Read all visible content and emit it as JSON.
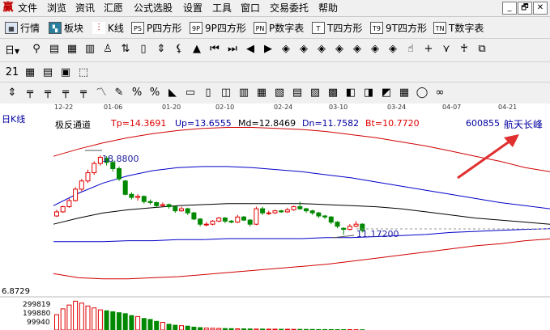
{
  "menubar": {
    "app_icon": "赢",
    "items": [
      "文件",
      "浏览",
      "资讯",
      "汇愿",
      "公式选股",
      "设置",
      "工具",
      "窗口",
      "交易委托",
      "帮助"
    ],
    "win_controls": [
      "_",
      "🗗",
      "✕"
    ]
  },
  "view_tabs": [
    {
      "icon": "grid-icon",
      "label": "行情"
    },
    {
      "icon": "blocks-icon",
      "label": "板块"
    },
    {
      "icon": "candle-icon",
      "label": "K线"
    },
    {
      "icon": "PS",
      "label": "P四方形"
    },
    {
      "icon": "9P",
      "label": "9P四方形"
    },
    {
      "icon": "PN",
      "label": "P数字表"
    },
    {
      "icon": "T",
      "label": "T四方形"
    },
    {
      "icon": "T9",
      "label": "9T四方形"
    },
    {
      "icon": "TN",
      "label": "T数字表"
    }
  ],
  "period_selector": "日",
  "toolbar2_glyphs": [
    "⚲",
    "▤",
    "▦",
    "▥",
    "♙",
    "⇅",
    "▯",
    "⇕",
    "⚸",
    "▲",
    "⏮",
    "⏭",
    "◀",
    "▶",
    "◈",
    "◈",
    "◈",
    "◈",
    "◈",
    "◈",
    "◈",
    "☝",
    "+",
    "⋎",
    "♰",
    "⧉"
  ],
  "toolbar3_glyphs": [
    "21",
    "▦",
    "▤",
    "▣",
    "⬚"
  ],
  "toolbar4_glyphs": [
    "⇕",
    "╤",
    "╤",
    "╤",
    "╤",
    "〽",
    "✎",
    "%",
    "%",
    "◣",
    "▭",
    "▯",
    "◫",
    "▥",
    "▦",
    "▧",
    "▤",
    "▨",
    "▩",
    "◧",
    "◨",
    "◩",
    "▦",
    "◯",
    "∞"
  ],
  "date_axis": [
    "12-22",
    "01-06",
    "01-20",
    "02-10",
    "02-24",
    "03-10",
    "03-24",
    "04-07",
    "04-21"
  ],
  "chart_title": "日K线",
  "indicator": {
    "name": "极反通道",
    "tp": "Tp=14.3691",
    "up": "Up=13.6555",
    "md": "Md=12.8469",
    "dn": "Dn=11.7582",
    "bt": "Bt=10.7720"
  },
  "stock": {
    "code": "600855",
    "name": "航天长峰"
  },
  "annotations": {
    "high_price": "18.8800",
    "low_price": "11.17200"
  },
  "y_labels": {
    "price_low": "6.8729",
    "vol_1": "299819",
    "vol_2": "199880",
    "vol_3": "99940"
  },
  "colors": {
    "up_candle": "#e00000",
    "down_candle": "#008800",
    "tp_band": "#d00000",
    "up_band": "#0000c8",
    "md_line": "#000000",
    "dn_band": "#0000c8",
    "bt_band": "#d00000",
    "arrow": "#e03030",
    "indicator_text": "#0000a0",
    "tp_text": "#e00000",
    "stock_text": "#0000a0"
  },
  "chart_data": {
    "type": "candlestick",
    "x": [
      "12-22",
      "01-06",
      "01-20",
      "02-10",
      "02-24",
      "03-10",
      "03-24",
      "04-07",
      "04-21"
    ],
    "candles": [
      {
        "open": 13.0,
        "close": 13.4,
        "high": 13.6,
        "low": 12.9
      },
      {
        "open": 13.4,
        "close": 13.9,
        "high": 14.0,
        "low": 13.3
      },
      {
        "open": 13.9,
        "close": 14.5,
        "high": 14.7,
        "low": 13.8
      },
      {
        "open": 14.5,
        "close": 15.6,
        "high": 15.8,
        "low": 14.4
      },
      {
        "open": 15.6,
        "close": 16.4,
        "high": 16.6,
        "low": 15.4
      },
      {
        "open": 16.4,
        "close": 17.2,
        "high": 17.5,
        "low": 16.2
      },
      {
        "open": 17.2,
        "close": 18.1,
        "high": 18.3,
        "low": 17.0
      },
      {
        "open": 18.1,
        "close": 18.7,
        "high": 18.88,
        "low": 17.9
      },
      {
        "open": 18.6,
        "close": 18.2,
        "high": 18.8,
        "low": 17.9
      },
      {
        "open": 18.2,
        "close": 17.6,
        "high": 18.4,
        "low": 17.3
      },
      {
        "open": 17.6,
        "close": 16.6,
        "high": 17.8,
        "low": 16.4
      },
      {
        "open": 16.4,
        "close": 15.1,
        "high": 16.5,
        "low": 15.0
      },
      {
        "open": 15.1,
        "close": 14.8,
        "high": 15.3,
        "low": 14.6
      },
      {
        "open": 14.8,
        "close": 14.9,
        "high": 15.1,
        "low": 14.5
      },
      {
        "open": 14.9,
        "close": 14.4,
        "high": 15.0,
        "low": 14.2
      },
      {
        "open": 14.4,
        "close": 14.3,
        "high": 14.6,
        "low": 14.1
      },
      {
        "open": 14.3,
        "close": 14.0,
        "high": 14.4,
        "low": 13.8
      },
      {
        "open": 14.0,
        "close": 14.1,
        "high": 14.3,
        "low": 13.9
      },
      {
        "open": 14.1,
        "close": 13.9,
        "high": 14.2,
        "low": 13.7
      },
      {
        "open": 13.9,
        "close": 13.5,
        "high": 14.0,
        "low": 13.3
      },
      {
        "open": 13.5,
        "close": 13.7,
        "high": 13.9,
        "low": 13.4
      },
      {
        "open": 13.7,
        "close": 13.3,
        "high": 13.8,
        "low": 13.1
      },
      {
        "open": 13.3,
        "close": 12.7,
        "high": 13.4,
        "low": 12.6
      },
      {
        "open": 12.7,
        "close": 12.2,
        "high": 12.8,
        "low": 12.0
      },
      {
        "open": 12.2,
        "close": 12.2,
        "high": 12.4,
        "low": 12.0
      },
      {
        "open": 12.2,
        "close": 12.5,
        "high": 12.6,
        "low": 12.1
      },
      {
        "open": 12.5,
        "close": 12.8,
        "high": 12.9,
        "low": 12.4
      },
      {
        "open": 12.8,
        "close": 12.5,
        "high": 12.9,
        "low": 12.3
      },
      {
        "open": 12.5,
        "close": 12.4,
        "high": 12.6,
        "low": 12.3
      },
      {
        "open": 12.4,
        "close": 12.9,
        "high": 13.1,
        "low": 12.3
      },
      {
        "open": 12.9,
        "close": 12.6,
        "high": 13.0,
        "low": 12.5
      },
      {
        "open": 12.6,
        "close": 12.2,
        "high": 12.7,
        "low": 12.0
      },
      {
        "open": 12.2,
        "close": 13.7,
        "high": 13.9,
        "low": 12.1
      },
      {
        "open": 13.7,
        "close": 13.3,
        "high": 13.9,
        "low": 13.1
      },
      {
        "open": 13.3,
        "close": 13.3,
        "high": 13.5,
        "low": 13.1
      },
      {
        "open": 13.3,
        "close": 13.5,
        "high": 13.6,
        "low": 13.2
      },
      {
        "open": 13.5,
        "close": 13.4,
        "high": 13.6,
        "low": 13.3
      },
      {
        "open": 13.4,
        "close": 13.6,
        "high": 13.8,
        "low": 13.3
      },
      {
        "open": 13.6,
        "close": 13.9,
        "high": 14.0,
        "low": 13.5
      },
      {
        "open": 13.9,
        "close": 13.7,
        "high": 14.4,
        "low": 13.6
      },
      {
        "open": 13.7,
        "close": 13.5,
        "high": 13.8,
        "low": 13.3
      },
      {
        "open": 13.5,
        "close": 13.3,
        "high": 13.6,
        "low": 13.1
      },
      {
        "open": 13.3,
        "close": 13.0,
        "high": 13.4,
        "low": 12.8
      },
      {
        "open": 13.0,
        "close": 12.9,
        "high": 13.1,
        "low": 12.7
      },
      {
        "open": 12.9,
        "close": 12.4,
        "high": 13.0,
        "low": 12.2
      },
      {
        "open": 12.4,
        "close": 12.0,
        "high": 12.5,
        "low": 11.8
      },
      {
        "open": 11.8,
        "close": 11.7,
        "high": 11.9,
        "low": 11.17
      },
      {
        "open": 11.7,
        "close": 12.0,
        "high": 12.2,
        "low": 11.6
      },
      {
        "open": 12.0,
        "close": 12.2,
        "high": 12.5,
        "low": 11.9
      },
      {
        "open": 12.2,
        "close": 11.6,
        "high": 12.3,
        "low": 11.4
      }
    ],
    "bands": {
      "Tp": [
        18.8,
        19.5,
        20.1,
        20.6,
        21.0,
        21.3,
        21.5,
        21.6,
        21.6,
        21.5,
        21.4,
        21.2,
        20.9,
        20.6,
        20.2,
        19.8,
        19.3,
        18.8,
        18.3,
        17.7,
        17.3
      ],
      "Up": [
        14.0,
        15.2,
        16.2,
        16.9,
        17.4,
        17.7,
        17.8,
        17.8,
        17.7,
        17.5,
        17.3,
        17.0,
        16.7,
        16.3,
        15.9,
        15.5,
        15.1,
        14.7,
        14.3,
        14.0,
        13.7
      ],
      "Md": [
        12.2,
        12.8,
        13.3,
        13.6,
        13.8,
        14.0,
        14.1,
        14.2,
        14.2,
        14.2,
        14.2,
        14.1,
        14.0,
        13.9,
        13.7,
        13.4,
        13.1,
        12.8,
        12.6,
        12.4,
        12.2
      ],
      "Dn": [
        10.5,
        10.5,
        10.5,
        10.6,
        10.6,
        10.7,
        10.7,
        10.8,
        10.8,
        10.8,
        10.8,
        10.9,
        10.9,
        11.0,
        11.1,
        11.2,
        11.4,
        11.5,
        11.6,
        11.7,
        11.76
      ],
      "Bt": [
        7.4,
        7.0,
        6.9,
        6.9,
        7.0,
        7.1,
        7.3,
        7.5,
        7.7,
        7.9,
        8.1,
        8.3,
        8.6,
        8.9,
        9.2,
        9.5,
        9.8,
        10.1,
        10.3,
        10.6,
        10.77
      ]
    },
    "volume": [
      160000,
      220000,
      260000,
      300000,
      280000,
      250000,
      230000,
      210000,
      200000,
      190000,
      180000,
      170000,
      150000,
      140000,
      120000,
      110000,
      90000,
      80000,
      60000,
      50000,
      45000,
      40000,
      30000,
      25000,
      20000,
      18000,
      16000,
      15000,
      14000,
      12000,
      12000,
      11000,
      10000,
      10000,
      9000,
      9000,
      8000,
      8000,
      7000,
      7000,
      6000,
      6000,
      5000,
      5000,
      5000,
      4000,
      4000,
      4000,
      3000,
      3000
    ],
    "ylim": [
      6.8729,
      21.8
    ]
  }
}
